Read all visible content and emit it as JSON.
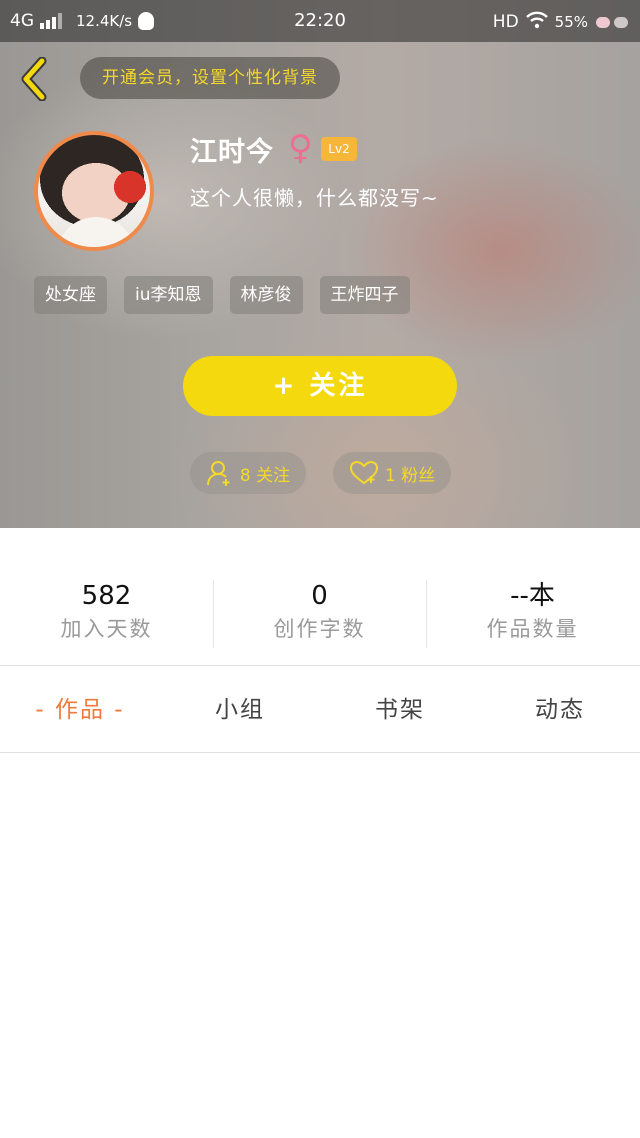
{
  "status_bar": {
    "network": "4G",
    "speed": "12.4K/s",
    "time": "22:20",
    "hd": "HD",
    "battery": "55%"
  },
  "header": {
    "vip_banner": "开通会员，设置个性化背景",
    "accent_color": "#f5d90f"
  },
  "profile": {
    "name": "江时今",
    "gender_symbol": "♀",
    "level": "Lv2",
    "bio": "这个人很懒，什么都没写~",
    "tags": [
      "处女座",
      "iu李知恩",
      "林彦俊",
      "王炸四子"
    ],
    "follow_button": "+ 关注",
    "following_label": "8 关注",
    "fans_label": "1 粉丝"
  },
  "stats": [
    {
      "value": "582",
      "label": "加入天数"
    },
    {
      "value": "0",
      "label": "创作字数"
    },
    {
      "value": "--本",
      "label": "作品数量"
    }
  ],
  "tabs": [
    {
      "label": "- 作品 -",
      "active": true
    },
    {
      "label": "小组",
      "active": false
    },
    {
      "label": "书架",
      "active": false
    },
    {
      "label": "动态",
      "active": false
    }
  ]
}
